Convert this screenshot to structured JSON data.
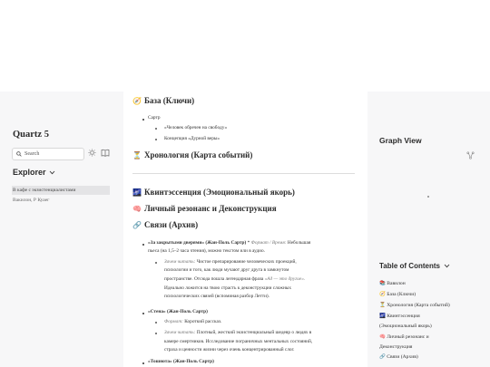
{
  "sidebar": {
    "site_title": "Quartz 5",
    "search_placeholder": "Search",
    "explorer_label": "Explorer",
    "items": [
      {
        "label": "В кафе с экзистенциалистами"
      },
      {
        "label": "Вакилон, Р Куаег"
      }
    ]
  },
  "content": {
    "h1": {
      "icon": "🧭",
      "text": "База (Ключи)"
    },
    "list1": {
      "item": "Сартр",
      "subitems": [
        "«Человек обречен на свободу»",
        "Концепция «Дурной веры»"
      ]
    },
    "h2": {
      "icon": "⏳",
      "text": "Хронология (Карта событий)"
    },
    "h3": {
      "icon": "🌌",
      "text": "Квинтэссенция (Эмоциональный якорь)"
    },
    "h4": {
      "icon": "🧠",
      "text": "Личный резонанс и Деконструкция"
    },
    "h5": {
      "icon": "🔗",
      "text": "Связи (Архив)"
    },
    "p1": {
      "title": "«За закрытыми дверями» (Жан-Поль Сартр)",
      "meta_label": "Формат / Время:",
      "meta_value": "Небольшая",
      "line2": "пьеса (на 1,5–2 часа чтения), можно текстом или в аудио.",
      "why_label": "Зачем читать:",
      "why_lines": [
        "Чистое препарирование человеческих проекций,",
        "психологии и того, как люди мучают друг друга в замкнутом",
        "пространстве. Отсюда пошла легендарная фраза",
        "Идеально ложится на твою страсть к деконструкции сложных",
        "психологических связей (вспоминая разбор Летти)."
      ],
      "quote": "«Ад — это другие»."
    },
    "p2": {
      "title": "«Стена» (Жан-Поль Сартр)",
      "format_label": "Формат:",
      "format_value": "Короткий рассказ.",
      "why_label": "Зачем читать:",
      "why_lines": [
        "Плотный, жесткий экзистенциальный шедевр о людях в",
        "камере смертников. Исследование пограничных ментальных состояний,",
        "страха и ценности жизни через очень концентрированный слог."
      ]
    },
    "p3": {
      "title": "«Тошнота» (Жан-Поль Сартр)"
    }
  },
  "right": {
    "graph_title": "Graph View",
    "toc_title": "Table of Contents",
    "toc": [
      {
        "icon": "📚",
        "text": "Вавилон"
      },
      {
        "icon": "🧭",
        "text": "База (Ключи)"
      },
      {
        "icon": "⏳",
        "text": "Хронология (Карта событий)"
      },
      {
        "icon": "🌌",
        "text": "Квинтэссенция"
      },
      {
        "icon": "",
        "text": "(Эмоциональный якорь)"
      },
      {
        "icon": "🧠",
        "text": "Личный резонанс и"
      },
      {
        "icon": "",
        "text": "Деконструкция"
      },
      {
        "icon": "🔗",
        "text": "Связи (Архив)"
      }
    ]
  }
}
